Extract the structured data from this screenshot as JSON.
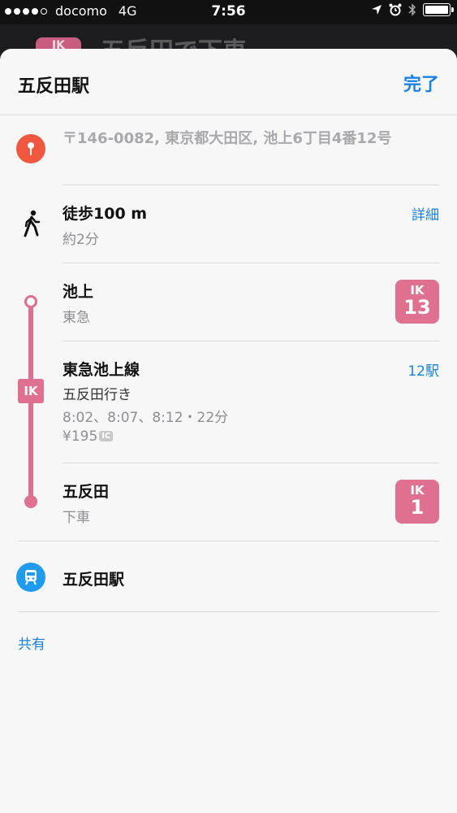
{
  "status_bar": {
    "carrier": "docomo",
    "network": "4G",
    "time": "7:56"
  },
  "background": {
    "badge_code": "IK",
    "title": "五反田で下車"
  },
  "header": {
    "title": "五反田駅",
    "done_label": "完了"
  },
  "address": "〒146-0082, 東京都大田区, 池上6丁目4番12号",
  "walk": {
    "title": "徒歩100 m",
    "duration": "約2分",
    "details_label": "詳細"
  },
  "board_station": {
    "name": "池上",
    "operator": "東急",
    "badge_code": "IK",
    "badge_number": "13"
  },
  "line": {
    "tag": "IK",
    "name": "東急池上線",
    "stops_label": "12駅",
    "direction": "五反田行き",
    "departures": "8:02、8:07、8:12・22分",
    "fare": "¥195",
    "fare_tag": "IC"
  },
  "alight_station": {
    "name": "五反田",
    "action": "下車",
    "badge_code": "IK",
    "badge_number": "1"
  },
  "destination": {
    "name": "五反田駅"
  },
  "share_label": "共有",
  "colors": {
    "accent": "#1a82e2",
    "line": "#e0708f",
    "pin": "#f0573f",
    "train": "#1f9bf0"
  }
}
